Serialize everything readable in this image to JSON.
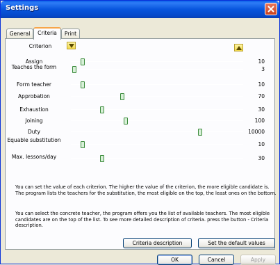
{
  "window": {
    "title": "Settings"
  },
  "tabs": [
    {
      "label": "General"
    },
    {
      "label": "Criteria"
    },
    {
      "label": "Print"
    }
  ],
  "criteria_header": {
    "label": "Criterion"
  },
  "criteria": [
    {
      "label": "Assign",
      "value": "10",
      "level": 0.07
    },
    {
      "label": "Teaches the form",
      "value": "3",
      "level": 0.02
    },
    {
      "label": "Form teacher",
      "value": "10",
      "level": 0.07
    },
    {
      "label": "Approbation",
      "value": "70",
      "level": 0.3
    },
    {
      "label": "Exhaustion",
      "value": "30",
      "level": 0.18
    },
    {
      "label": "Joining",
      "value": "100",
      "level": 0.32
    },
    {
      "label": "Duty",
      "value": "10000",
      "level": 0.75
    },
    {
      "label": "Equable substitution",
      "value": "10",
      "level": 0.07
    },
    {
      "label": "Max. lessons/day",
      "value": "30",
      "level": 0.18
    }
  ],
  "description": {
    "para1": "You can set the value of each criterion. The higher the value of the criterion, the more eligible candidate is. The program lists the teachers for the substitution, the most eligible on the top, the least ones on the bottom.",
    "para2": "You can select the concrete teacher, the program offers you the list of available teachers. The most eligible candidates are on the top of the list. To see more detailed description of criteria. press the button - Criteria description."
  },
  "buttons": {
    "criteria_description": "Criteria description",
    "set_defaults": "Set the default values",
    "ok": "OK",
    "cancel": "Cancel",
    "apply": "Apply"
  },
  "colors": {
    "titlebar": "#0855dd",
    "tab_highlight": "#f7a54a",
    "slider_thumb": "#3a8a3a"
  }
}
